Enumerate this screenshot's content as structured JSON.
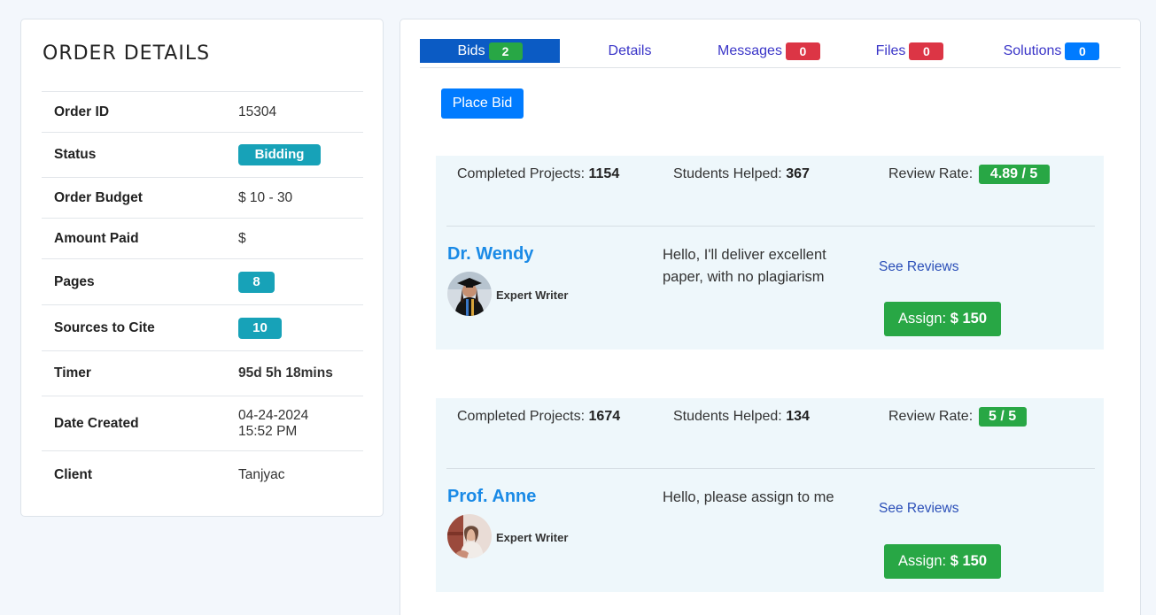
{
  "order": {
    "title": "ORDER DETAILS",
    "rows": [
      {
        "label": "Order ID",
        "value": "15304"
      },
      {
        "label": "Status",
        "value": "Bidding"
      },
      {
        "label": "Order Budget",
        "value": "$ 10 - 30"
      },
      {
        "label": "Amount Paid",
        "value": "$"
      },
      {
        "label": "Pages",
        "value": "8"
      },
      {
        "label": "Sources to Cite",
        "value": "10"
      },
      {
        "label": "Timer",
        "value": "95d 5h 18mins"
      },
      {
        "label": "Date Created",
        "value_line1": "04-24-2024",
        "value_line2": "15:52 PM"
      },
      {
        "label": "Client",
        "value": "Tanjyac"
      }
    ]
  },
  "tabs": [
    {
      "label": "Bids",
      "count": "2"
    },
    {
      "label": "Details"
    },
    {
      "label": "Messages",
      "count": "0"
    },
    {
      "label": "Files",
      "count": "0"
    },
    {
      "label": "Solutions",
      "count": "0"
    }
  ],
  "place_bid_label": "Place Bid",
  "bids": [
    {
      "completed_label": "Completed Projects:",
      "completed": "1154",
      "helped_label": "Students Helped:",
      "helped": "367",
      "rate_label": "Review Rate:",
      "rate": "4.89 / 5",
      "name": "Dr. Wendy",
      "role": "Expert Writer",
      "message": "Hello, I'll deliver excellent paper, with no plagiarism",
      "reviews_label": "See Reviews",
      "assign_label": "Assign:",
      "assign_amount": "$ 150"
    },
    {
      "completed_label": "Completed Projects:",
      "completed": "1674",
      "helped_label": "Students Helped:",
      "helped": "134",
      "rate_label": "Review Rate:",
      "rate": "5 / 5",
      "name": "Prof. Anne",
      "role": "Expert Writer",
      "message": "Hello, please assign to me",
      "reviews_label": "See Reviews",
      "assign_label": "Assign:",
      "assign_amount": "$ 150"
    }
  ],
  "colors": {
    "accent_blue": "#007bff",
    "tab_active": "#0b5bc4",
    "success_green": "#28a745",
    "danger_red": "#dc3545",
    "info_teal": "#17a2b8",
    "name_blue": "#1a8ae6"
  }
}
